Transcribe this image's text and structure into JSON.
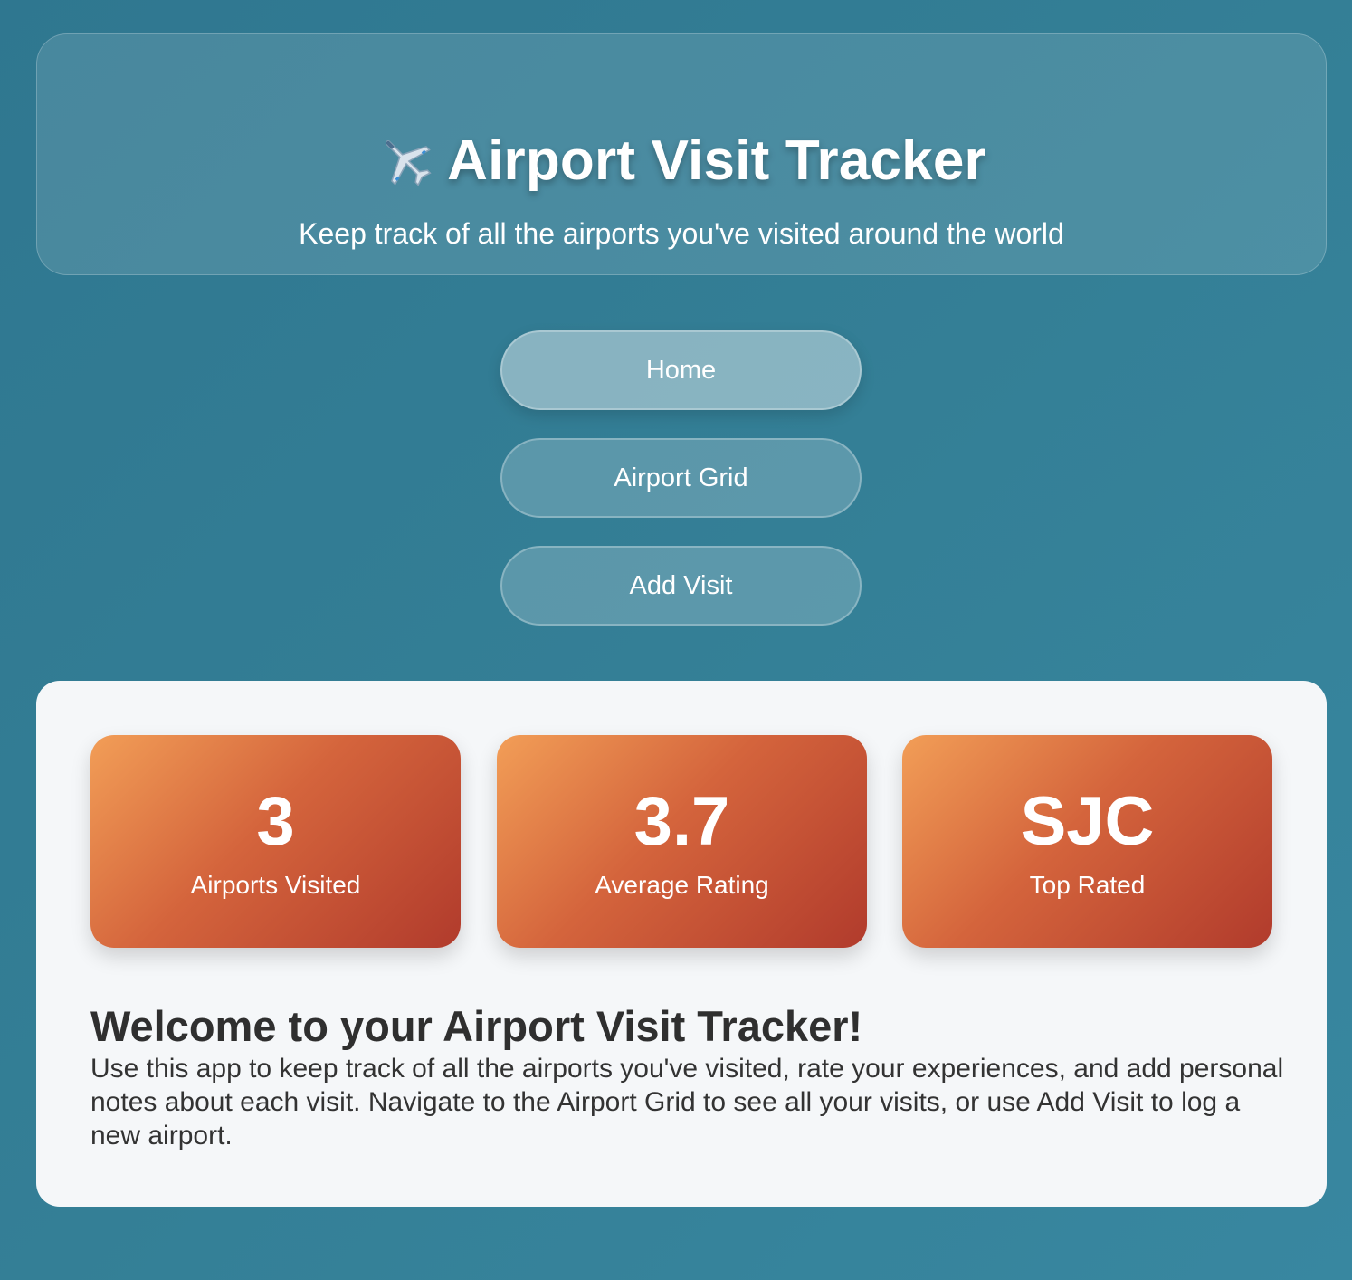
{
  "header": {
    "icon": "airplane-icon",
    "title": "Airport Visit Tracker",
    "subtitle": "Keep track of all the airports you've visited around the world"
  },
  "nav": {
    "items": [
      {
        "label": "Home",
        "active": true
      },
      {
        "label": "Airport Grid",
        "active": false
      },
      {
        "label": "Add Visit",
        "active": false
      }
    ]
  },
  "stats": [
    {
      "value": "3",
      "label": "Airports Visited"
    },
    {
      "value": "3.7",
      "label": "Average Rating"
    },
    {
      "value": "SJC",
      "label": "Top Rated"
    }
  ],
  "welcome": {
    "title": "Welcome to your Airport Visit Tracker!",
    "text": "Use this app to keep track of all the airports you've visited, rate your experiences, and add personal notes about each visit. Navigate to the Airport Grid to see all your visits, or use Add Visit to log a new airport."
  },
  "colors": {
    "background": "#347f96",
    "card_gradient_start": "#f29e57",
    "card_gradient_end": "#b13b2c",
    "panel": "#f5f7f9"
  }
}
